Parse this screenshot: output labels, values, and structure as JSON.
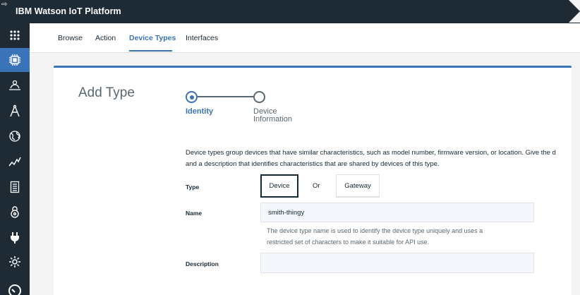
{
  "header": {
    "title": "IBM Watson IoT Platform",
    "corner_icon": "arrow-right-icon"
  },
  "sidebar": {
    "items": [
      {
        "icon": "app-grid-icon",
        "active": false
      },
      {
        "icon": "chip-icon",
        "active": true
      },
      {
        "icon": "members-icon",
        "active": false
      },
      {
        "icon": "compass-icon",
        "active": false
      },
      {
        "icon": "globe-icon",
        "active": false
      },
      {
        "icon": "analytics-icon",
        "active": false
      },
      {
        "icon": "document-icon",
        "active": false
      },
      {
        "icon": "security-icon",
        "active": false
      },
      {
        "icon": "plug-icon",
        "active": false
      },
      {
        "icon": "gear-icon",
        "active": false
      },
      {
        "icon": "help-icon",
        "active": false
      }
    ]
  },
  "tabs": [
    {
      "label": "Browse",
      "active": false
    },
    {
      "label": "Action",
      "active": false
    },
    {
      "label": "Device Types",
      "active": true
    },
    {
      "label": "Interfaces",
      "active": false
    }
  ],
  "form": {
    "title": "Add Type",
    "steps": [
      {
        "label": "Identity",
        "state": "current"
      },
      {
        "label_line1": "Device",
        "label_line2": "Information",
        "state": "next"
      }
    ],
    "intro_line1": "Device types group devices that have similar characteristics, such as model number, firmware version, or location. Give the d",
    "intro_line2": "and a description that identifies characteristics that are shared by devices of this type.",
    "type_label": "Type",
    "type_options": {
      "device": "Device",
      "or": "Or",
      "gateway": "Gateway",
      "selected": "Device"
    },
    "name_label": "Name",
    "name_value": "smith-thingy",
    "name_help_line1": "The device type name is used to identify the device type uniquely and uses a",
    "name_help_line2": "restricted set of characters to make it suitable for API use.",
    "description_label": "Description",
    "description_value": ""
  },
  "colors": {
    "accent": "#3b73b9",
    "nav_bg": "#1e2b35",
    "text": "#152935",
    "muted": "#5a6872"
  }
}
